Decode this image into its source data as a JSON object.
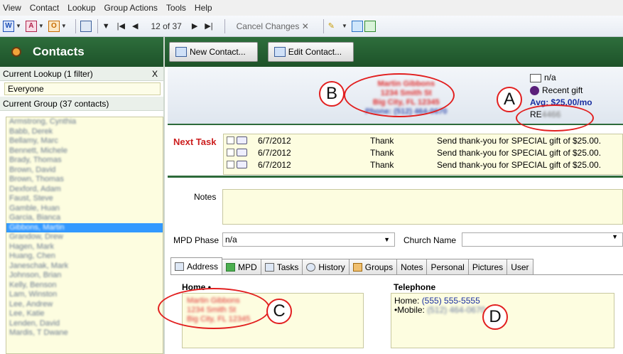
{
  "menu": [
    "View",
    "Contact",
    "Lookup",
    "Group Actions",
    "Tools",
    "Help"
  ],
  "toolbar": {
    "word_icon": "W",
    "access_icon": "A",
    "outlook_icon": "O",
    "record_position": "12 of 37",
    "cancel_changes": "Cancel Changes"
  },
  "sidebar": {
    "title": "Contacts",
    "current_lookup": "Current Lookup (1 filter)",
    "clear_label": "X",
    "lookup_value": "Everyone",
    "current_group": "Current Group (37 contacts)",
    "contacts": [
      "Armstrong, Cynthia",
      "Babb, Derek",
      "Bellamy, Marc",
      "Bennett, Michele",
      "Brady, Thomas",
      "Brown, David",
      "Brown, Thomas",
      "Dexford, Adam",
      "Faust, Steve",
      "Gamble, Huan",
      "Garcia, Bianca",
      "Gibbons, Martin",
      "Grandow, Drew",
      "Hagen, Mark",
      "Huang, Chen",
      "Janeschak, Mark",
      "Johnson, Brian",
      "Kelly, Benson",
      "Lam, Winston",
      "Lee, Andrew",
      "Lee, Katie",
      "Lenden, David",
      "Mardis, T Dwane"
    ],
    "selected_index": 11
  },
  "actions": {
    "new_contact": "New Contact...",
    "edit_contact": "Edit Contact..."
  },
  "contact": {
    "name": "Martin Gibbons",
    "street": "1234 Smith St",
    "city": "Big City, FL 12345",
    "phone_line": "Phone: (512) 464-0670",
    "na_label": "n/a",
    "recent_gift": "Recent gift",
    "avg": "Avg: $25.00/mo",
    "re_prefix": "RE",
    "re_code": "4466"
  },
  "tasks": {
    "label": "Next Task",
    "rows": [
      {
        "date": "6/7/2012",
        "type": "Thank",
        "desc": "Send thank-you for SPECIAL gift of $25.00."
      },
      {
        "date": "6/7/2012",
        "type": "Thank",
        "desc": "Send thank-you for SPECIAL gift of $25.00."
      },
      {
        "date": "6/7/2012",
        "type": "Thank",
        "desc": "Send thank-you for SPECIAL gift of $25.00."
      }
    ]
  },
  "fields": {
    "notes_label": "Notes",
    "mpd_phase_label": "MPD Phase",
    "mpd_phase_value": "n/a",
    "church_name_label": "Church Name"
  },
  "tabs": [
    "Address",
    "MPD",
    "Tasks",
    "History",
    "Groups",
    "Notes",
    "Personal",
    "Pictures",
    "User"
  ],
  "address": {
    "home_title": "Home",
    "home_lines": [
      "Martin Gibbons",
      "1234 Smith St",
      "Big City, FL 12345"
    ],
    "telephone_title": "Telephone",
    "home_phone_label": "Home: ",
    "home_phone": "(555) 555-5555",
    "mobile_label": "Mobile: ",
    "mobile_phone": "(512) 464-0670"
  },
  "annotations": [
    "A",
    "B",
    "C",
    "D"
  ],
  "colors": {
    "accent_green": "#2d6a3a",
    "annotation_red": "#e21f1f",
    "field_yellow": "#fdfde0"
  }
}
